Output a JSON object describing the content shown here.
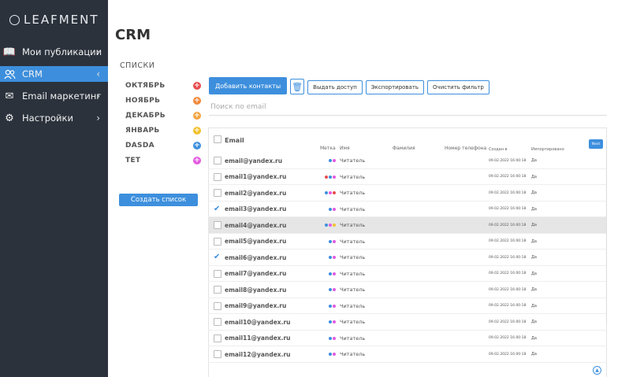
{
  "brand": {
    "logo_text": "LEAFMENT"
  },
  "sidebar": {
    "items": [
      {
        "label": "Мои публикации",
        "icon": "book-icon"
      },
      {
        "label": "CRM",
        "icon": "users-icon",
        "active": true
      },
      {
        "label": "Email маркетинг",
        "icon": "mail-icon"
      },
      {
        "label": "Настройки",
        "icon": "gear-icon"
      }
    ]
  },
  "page": {
    "title": "CRM"
  },
  "lists": {
    "heading": "СПИСКИ",
    "items": [
      {
        "label": "ОКТЯБРЬ",
        "color": "#e84c4c"
      },
      {
        "label": "НОЯБРЬ",
        "color": "#f08a3c"
      },
      {
        "label": "ДЕКАБРЬ",
        "color": "#f2a541"
      },
      {
        "label": "ЯНВАРЬ",
        "color": "#f2c12e"
      },
      {
        "label": "DASDA",
        "color": "#3d8fdd"
      },
      {
        "label": "TET",
        "color": "#e35ae0"
      }
    ],
    "create_button": "Создать список"
  },
  "toolbar": {
    "add_contacts": "Добавить контакты",
    "give_access": "Выдать доступ",
    "export": "Экспортировать",
    "clear_filter": "Очистить фильтр"
  },
  "search": {
    "placeholder": "Поиск по email"
  },
  "pagination": {
    "next_label": "Next"
  },
  "table": {
    "columns": {
      "email": "Email",
      "tag": "Метка",
      "name": "Имя",
      "last_name": "Фамилия",
      "phone": "Номер телефона",
      "created": "Создан в",
      "imported": "Импортировано"
    },
    "rows": [
      {
        "email": "email@yandex.ru",
        "tags": [
          "#3d8fdd",
          "#e35ae0"
        ],
        "role": "Читатель",
        "created": "09.02.2022 16:00:18",
        "imported": "Да",
        "checked": false,
        "highlighted": false
      },
      {
        "email": "email1@yandex.ru",
        "tags": [
          "#e84c4c",
          "#3d8fdd",
          "#e35ae0"
        ],
        "role": "Читатель",
        "created": "09.02.2022 16:00:18",
        "imported": "Да",
        "checked": false,
        "highlighted": false
      },
      {
        "email": "email2@yandex.ru",
        "tags": [
          "#3d8fdd",
          "#e35ae0",
          "#e84c4c"
        ],
        "role": "Читатель",
        "created": "09.02.2022 16:00:18",
        "imported": "Да",
        "checked": false,
        "highlighted": false
      },
      {
        "email": "email3@yandex.ru",
        "tags": [
          "#3d8fdd",
          "#e35ae0"
        ],
        "role": "Читатель",
        "created": "09.02.2022 16:00:18",
        "imported": "Да",
        "checked": true,
        "highlighted": false
      },
      {
        "email": "email4@yandex.ru",
        "tags": [
          "#3d8fdd",
          "#e35ae0",
          "#f2c12e"
        ],
        "role": "Читатель",
        "created": "09.02.2022 16:00:18",
        "imported": "Да",
        "checked": false,
        "highlighted": true
      },
      {
        "email": "email5@yandex.ru",
        "tags": [
          "#3d8fdd",
          "#e35ae0"
        ],
        "role": "Читатель",
        "created": "09.02.2022 16:00:18",
        "imported": "Да",
        "checked": false,
        "highlighted": false
      },
      {
        "email": "email6@yandex.ru",
        "tags": [
          "#3d8fdd",
          "#e35ae0"
        ],
        "role": "Читатель",
        "created": "09.02.2022 16:00:18",
        "imported": "Да",
        "checked": true,
        "highlighted": false
      },
      {
        "email": "email7@yandex.ru",
        "tags": [
          "#3d8fdd",
          "#e35ae0"
        ],
        "role": "Читатель",
        "created": "09.02.2022 16:00:18",
        "imported": "Да",
        "checked": false,
        "highlighted": false
      },
      {
        "email": "email8@yandex.ru",
        "tags": [
          "#3d8fdd",
          "#e35ae0"
        ],
        "role": "Читатель",
        "created": "09.02.2022 16:00:18",
        "imported": "Да",
        "checked": false,
        "highlighted": false
      },
      {
        "email": "email9@yandex.ru",
        "tags": [
          "#3d8fdd",
          "#e35ae0"
        ],
        "role": "Читатель",
        "created": "09.02.2022 16:00:18",
        "imported": "Да",
        "checked": false,
        "highlighted": false
      },
      {
        "email": "email10@yandex.ru",
        "tags": [
          "#3d8fdd",
          "#e35ae0"
        ],
        "role": "Читатель",
        "created": "09.02.2022 16:00:18",
        "imported": "Да",
        "checked": false,
        "highlighted": false
      },
      {
        "email": "email11@yandex.ru",
        "tags": [
          "#3d8fdd",
          "#e35ae0"
        ],
        "role": "Читатель",
        "created": "09.02.2022 16:00:18",
        "imported": "Да",
        "checked": false,
        "highlighted": false
      },
      {
        "email": "email12@yandex.ru",
        "tags": [
          "#3d8fdd",
          "#e35ae0"
        ],
        "role": "Читатель",
        "created": "09.02.2022 16:00:18",
        "imported": "Да",
        "checked": false,
        "highlighted": false
      }
    ]
  },
  "colors": {
    "accent": "#3d8fdd",
    "sidebar_bg": "#2b323c",
    "row_highlight": "#e6e6e6"
  }
}
